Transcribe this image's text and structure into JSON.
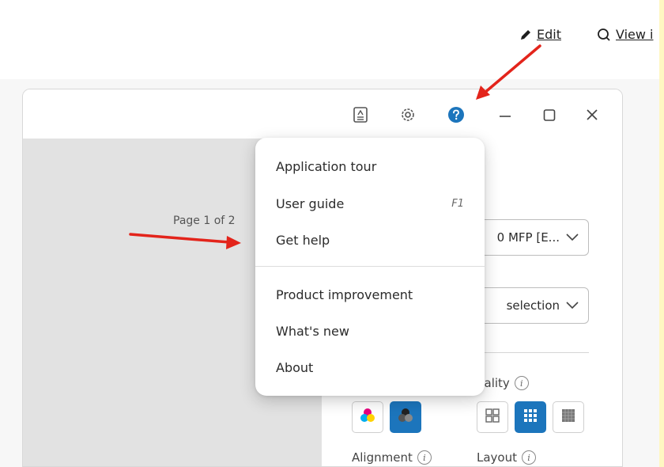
{
  "top_bar": {
    "edit_label": "Edit",
    "view_label": "View i"
  },
  "window": {
    "page_indicator": "Page 1 of 2",
    "printer_select_value": "0 MFP [E...",
    "pages_select_value": "selection",
    "quality_label": "uality",
    "alignment_label": "Alignment",
    "layout_label": "Layout"
  },
  "help_menu": {
    "items": [
      {
        "label": "Application tour",
        "shortcut": ""
      },
      {
        "label": "User guide",
        "shortcut": "F1"
      },
      {
        "label": "Get help",
        "shortcut": ""
      },
      {
        "label": "Product improvement",
        "shortcut": ""
      },
      {
        "label": "What's new",
        "shortcut": ""
      },
      {
        "label": "About",
        "shortcut": ""
      }
    ]
  },
  "icons": {
    "edit": "pencil-icon",
    "view": "search-icon",
    "toolbar": [
      "document-icon",
      "gear-icon",
      "help-icon",
      "minimize-icon",
      "maximize-icon",
      "close-icon"
    ]
  },
  "colors": {
    "accent": "#1c75bc",
    "arrow": "#e3241b",
    "preview_bg": "#e2e2e2"
  }
}
